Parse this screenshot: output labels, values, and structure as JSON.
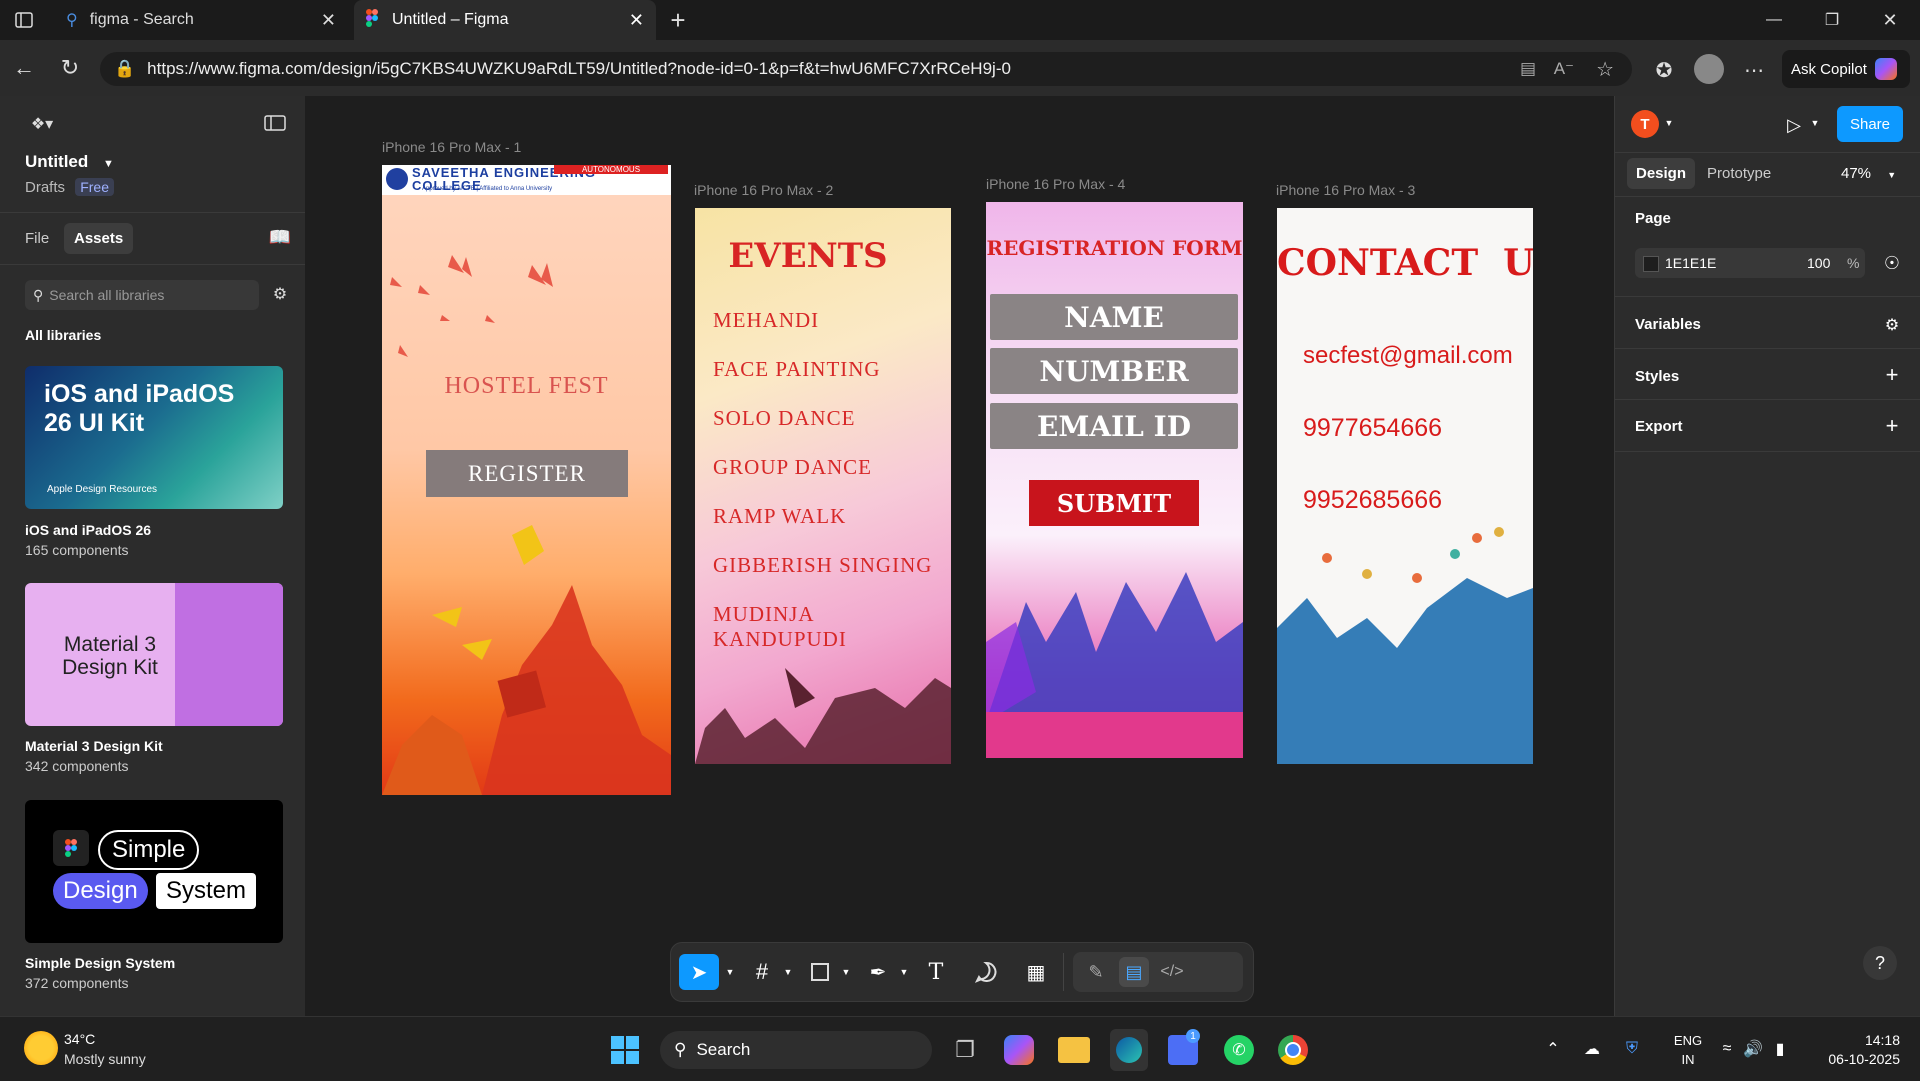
{
  "browser": {
    "tabs": [
      {
        "label": "figma - Search"
      },
      {
        "label": "Untitled – Figma"
      }
    ],
    "url": "https://www.figma.com/design/i5gC7KBS4UWZKU9aRdLT59/Untitled?node-id=0-1&p=f&t=hwU6MFC7XrRCeH9j-0",
    "ask_copilot": "Ask Copilot"
  },
  "left_panel": {
    "file_title": "Untitled",
    "drafts": "Drafts",
    "plan_badge": "Free",
    "tab_file": "File",
    "tab_assets": "Assets",
    "search_placeholder": "Search all libraries",
    "section": "All libraries",
    "libraries": [
      {
        "card_text": "iOS and iPadOS 26 UI Kit",
        "card_sub": "Apple Design Resources",
        "name": "iOS and iPadOS 26",
        "count": "165 components"
      },
      {
        "card_text": "Material 3 Design Kit",
        "name": "Material 3 Design Kit",
        "count": "342 components"
      },
      {
        "card_words": [
          "Simple",
          "Design",
          "System"
        ],
        "name": "Simple Design System",
        "count": "372 components"
      }
    ]
  },
  "right_panel": {
    "avatar_letter": "T",
    "share": "Share",
    "tab_design": "Design",
    "tab_prototype": "Prototype",
    "zoom": "47%",
    "page_heading": "Page",
    "page_color": "1E1E1E",
    "page_opacity": "100",
    "percent": "%",
    "variables": "Variables",
    "styles": "Styles",
    "export": "Export",
    "help": "?"
  },
  "frames": {
    "f1": {
      "label": "iPhone 16 Pro Max - 1",
      "college": "SAVEETHA ENGINEERING COLLEGE",
      "autonomous": "AUTONOMOUS",
      "approved": "Approved by AICTE | Affiliated to Anna University",
      "title": "HOSTEL FEST",
      "button": "REGISTER"
    },
    "f2": {
      "label": "iPhone 16 Pro Max - 2",
      "title": "EVENTS",
      "events": [
        "MEHANDI",
        "FACE PAINTING",
        "SOLO DANCE",
        "GROUP DANCE",
        "RAMP  WALK",
        "GIBBERISH SINGING",
        "MUDINJA KANDUPUDI"
      ]
    },
    "f4": {
      "label": "iPhone 16 Pro Max - 4",
      "title": "REGISTRATION FORM",
      "fields": [
        "NAME",
        "NUMBER",
        "EMAIL ID"
      ],
      "submit": "SUBMIT"
    },
    "f3": {
      "label": "iPhone 16 Pro Max - 3",
      "title": "CONTACT  US",
      "email": "secfest@gmail.com",
      "phone1": "9977654666",
      "phone2": "9952685666"
    }
  },
  "taskbar": {
    "temp": "34°C",
    "weather": "Mostly sunny",
    "search": "Search",
    "notification_badge": "1",
    "lang1": "ENG",
    "lang2": "IN",
    "time": "14:18",
    "date": "06-10-2025"
  }
}
